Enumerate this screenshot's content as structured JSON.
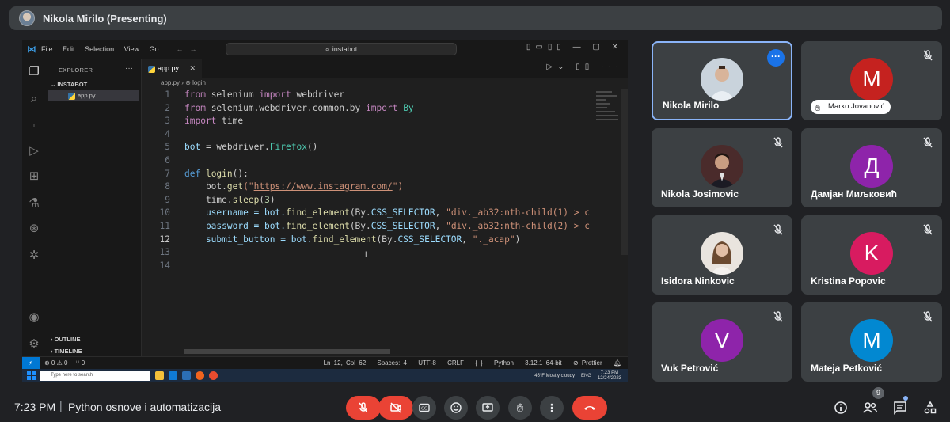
{
  "presenter": {
    "name": "Nikola Mirilo (Presenting)"
  },
  "vscode": {
    "menu": [
      "File",
      "Edit",
      "Selection",
      "View",
      "Go"
    ],
    "command_center": "instabot",
    "explorer_title": "EXPLORER",
    "folder": "INSTABOT",
    "file": "app.py",
    "outline": "OUTLINE",
    "timeline": "TIMELINE",
    "tab": "app.py",
    "breadcrumb_file": "app.py",
    "breadcrumb_symbol": "login",
    "code": {
      "l1_kw": "from",
      "l1_mod": " selenium ",
      "l1_imp": "import",
      "l1_name": " webdriver",
      "l2_kw": "from",
      "l2_mod": " selenium.webdriver.common.by ",
      "l2_imp": "import",
      "l2_name": " By",
      "l3_kw": "import",
      "l3_name": " time",
      "l5_var": "bot",
      "l5_eq": " = webdriver.",
      "l5_fn": "Firefox",
      "l5_end": "()",
      "l7_kw": "def",
      "l7_fn": " login",
      "l7_end": "():",
      "l8_a": "    bot.",
      "l8_fn": "get",
      "l8_b": "(\"",
      "l8_url": "https://www.instagram.com/",
      "l8_c": "\")",
      "l9_a": "    time.",
      "l9_fn": "sleep",
      "l9_b": "(",
      "l9_num": "3",
      "l9_c": ")",
      "l10_a": "    username = bot.",
      "l10_fn": "find_element",
      "l10_b": "(By.",
      "l10_c": "CSS_SELECTOR",
      "l10_d": ", ",
      "l10_str": "\"div._ab32:nth-child(1) > c",
      "l11_a": "    password = bot.",
      "l11_fn": "find_element",
      "l11_b": "(By.",
      "l11_c": "CSS_SELECTOR",
      "l11_d": ", ",
      "l11_str": "\"div._ab32:nth-child(2) > c",
      "l12_a": "    submit_button = bot.",
      "l12_fn": "find_element",
      "l12_b": "(By.",
      "l12_c": "CSS_SELECTOR",
      "l12_d": ", ",
      "l12_str": "\"._acap\"",
      "l12_e": ")"
    },
    "line_numbers": [
      "1",
      "2",
      "3",
      "4",
      "5",
      "6",
      "7",
      "8",
      "9",
      "10",
      "11",
      "12",
      "13",
      "14"
    ],
    "status": {
      "problems": "⊗ 0 ⚠ 0",
      "ports": "⑂ 0",
      "position": "Ln 12, Col 62",
      "spaces": "Spaces: 4",
      "encoding": "UTF-8",
      "eol": "CRLF",
      "language": "Python",
      "interpreter": "3.12.1 64-bit",
      "prettier": "⊘ Prettier"
    },
    "taskbar": {
      "search": "Type here to search",
      "weather": "45°F  Mostly cloudy",
      "lang": "ENG",
      "time": "7:23 PM",
      "date": "12/24/2023"
    }
  },
  "participants": [
    {
      "name": "Nikola Mirilo"
    },
    {
      "name": "Marko Jovanović",
      "letter": "M",
      "color": "#c5221f"
    },
    {
      "name": "Nikola Josimovic"
    },
    {
      "name": "Дамјан Миљковић",
      "letter": "Д",
      "color": "#8e24aa"
    },
    {
      "name": "Isidora Ninkovic"
    },
    {
      "name": "Kristina Popovic",
      "letter": "K",
      "color": "#d81b60"
    },
    {
      "name": "Vuk Petrović",
      "letter": "V",
      "color": "#8e24aa"
    },
    {
      "name": "Mateja Petković",
      "letter": "M",
      "color": "#0288d1"
    }
  ],
  "meeting": {
    "time": "7:23 PM",
    "separator": "|",
    "title": "Python osnove i automatizacija",
    "people_count": "9"
  }
}
